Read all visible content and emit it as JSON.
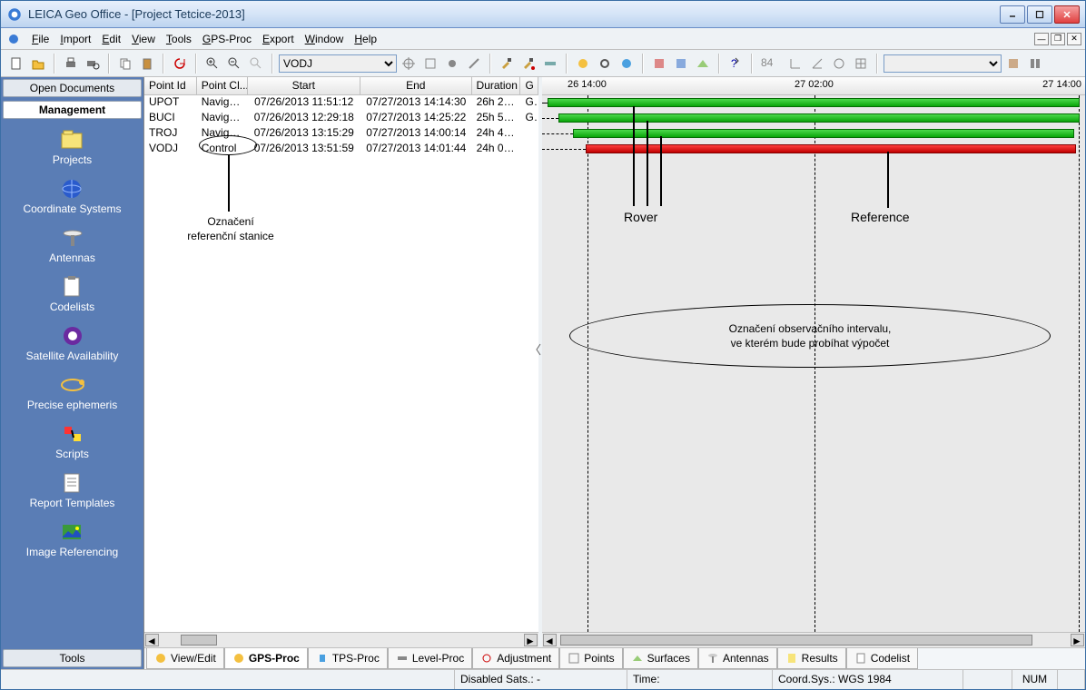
{
  "window": {
    "title": "LEICA Geo Office - [Project Tetcice-2013]"
  },
  "menu": {
    "file": "File",
    "import": "Import",
    "edit": "Edit",
    "view": "View",
    "tools": "Tools",
    "gps": "GPS-Proc",
    "export": "Export",
    "window": "Window",
    "help": "Help"
  },
  "toolbar": {
    "combo1": "VODJ",
    "combo2": ""
  },
  "sidebar": {
    "head_open": "Open Documents",
    "head_mgmt": "Management",
    "head_tools": "Tools",
    "items": [
      {
        "label": "Projects"
      },
      {
        "label": "Coordinate Systems"
      },
      {
        "label": "Antennas"
      },
      {
        "label": "Codelists"
      },
      {
        "label": "Satellite Availability"
      },
      {
        "label": "Precise ephemeris"
      },
      {
        "label": "Scripts"
      },
      {
        "label": "Report Templates"
      },
      {
        "label": "Image Referencing"
      }
    ]
  },
  "table": {
    "headers": {
      "pointid": "Point Id",
      "pointcl": "Point Cl...",
      "start": "Start",
      "end": "End",
      "duration": "Duration",
      "g": "G"
    },
    "rows": [
      {
        "id": "UPOT",
        "cl": "Navigat...",
        "start": "07/26/2013 11:51:12",
        "end": "07/27/2013 14:14:30",
        "dur": "26h 23'...",
        "g": "GP"
      },
      {
        "id": "BUCI",
        "cl": "Navigat...",
        "start": "07/26/2013 12:29:18",
        "end": "07/27/2013 14:25:22",
        "dur": "25h 56'...",
        "g": "GP"
      },
      {
        "id": "TROJ",
        "cl": "Navigat...",
        "start": "07/26/2013 13:15:29",
        "end": "07/27/2013 14:00:14",
        "dur": "24h 44'...",
        "g": ""
      },
      {
        "id": "VODJ",
        "cl": "Control",
        "start": "07/26/2013 13:51:59",
        "end": "07/27/2013 14:01:44",
        "dur": "24h 09'...",
        "g": ""
      }
    ]
  },
  "annotations": {
    "ref_station": "Označení\nreferenční stanice",
    "ref_station_l1": "Označení",
    "ref_station_l2": "referenční stanice",
    "rover": "Rover",
    "reference": "Reference",
    "interval_l1": "Označení observačního intervalu,",
    "interval_l2": "ve kterém bude probíhat výpočet"
  },
  "timeline": {
    "ticks": [
      {
        "pos": 40,
        "label": "26 14:00"
      },
      {
        "pos": 290,
        "label": "27 02:00"
      },
      {
        "pos": 540,
        "label": "27 14:00"
      }
    ]
  },
  "tabs": {
    "viewedit": "View/Edit",
    "gps": "GPS-Proc",
    "tps": "TPS-Proc",
    "level": "Level-Proc",
    "adj": "Adjustment",
    "points": "Points",
    "surfaces": "Surfaces",
    "antennas": "Antennas",
    "results": "Results",
    "codelist": "Codelist"
  },
  "status": {
    "sats": "Disabled Sats.: -",
    "time": "Time:",
    "coord": "Coord.Sys.: WGS 1984",
    "num": "NUM"
  },
  "chart_data": {
    "type": "bar",
    "note": "GPS observation timeline (gantt-style). Times approximate from axis.",
    "x_labels": [
      "26 14:00",
      "27 02:00",
      "27 14:00"
    ],
    "series": [
      {
        "name": "UPOT",
        "color": "green",
        "start": "07/26/2013 11:51",
        "end": "07/27/2013 14:14"
      },
      {
        "name": "BUCI",
        "color": "green",
        "start": "07/26/2013 12:29",
        "end": "07/27/2013 14:25"
      },
      {
        "name": "TROJ",
        "color": "green",
        "start": "07/26/2013 13:15",
        "end": "07/27/2013 14:00"
      },
      {
        "name": "VODJ",
        "color": "red",
        "start": "07/26/2013 13:51",
        "end": "07/27/2013 14:01"
      }
    ],
    "highlight_interval": {
      "start": "07/26/2013 14:00",
      "end": "07/27/2013 14:00"
    }
  }
}
